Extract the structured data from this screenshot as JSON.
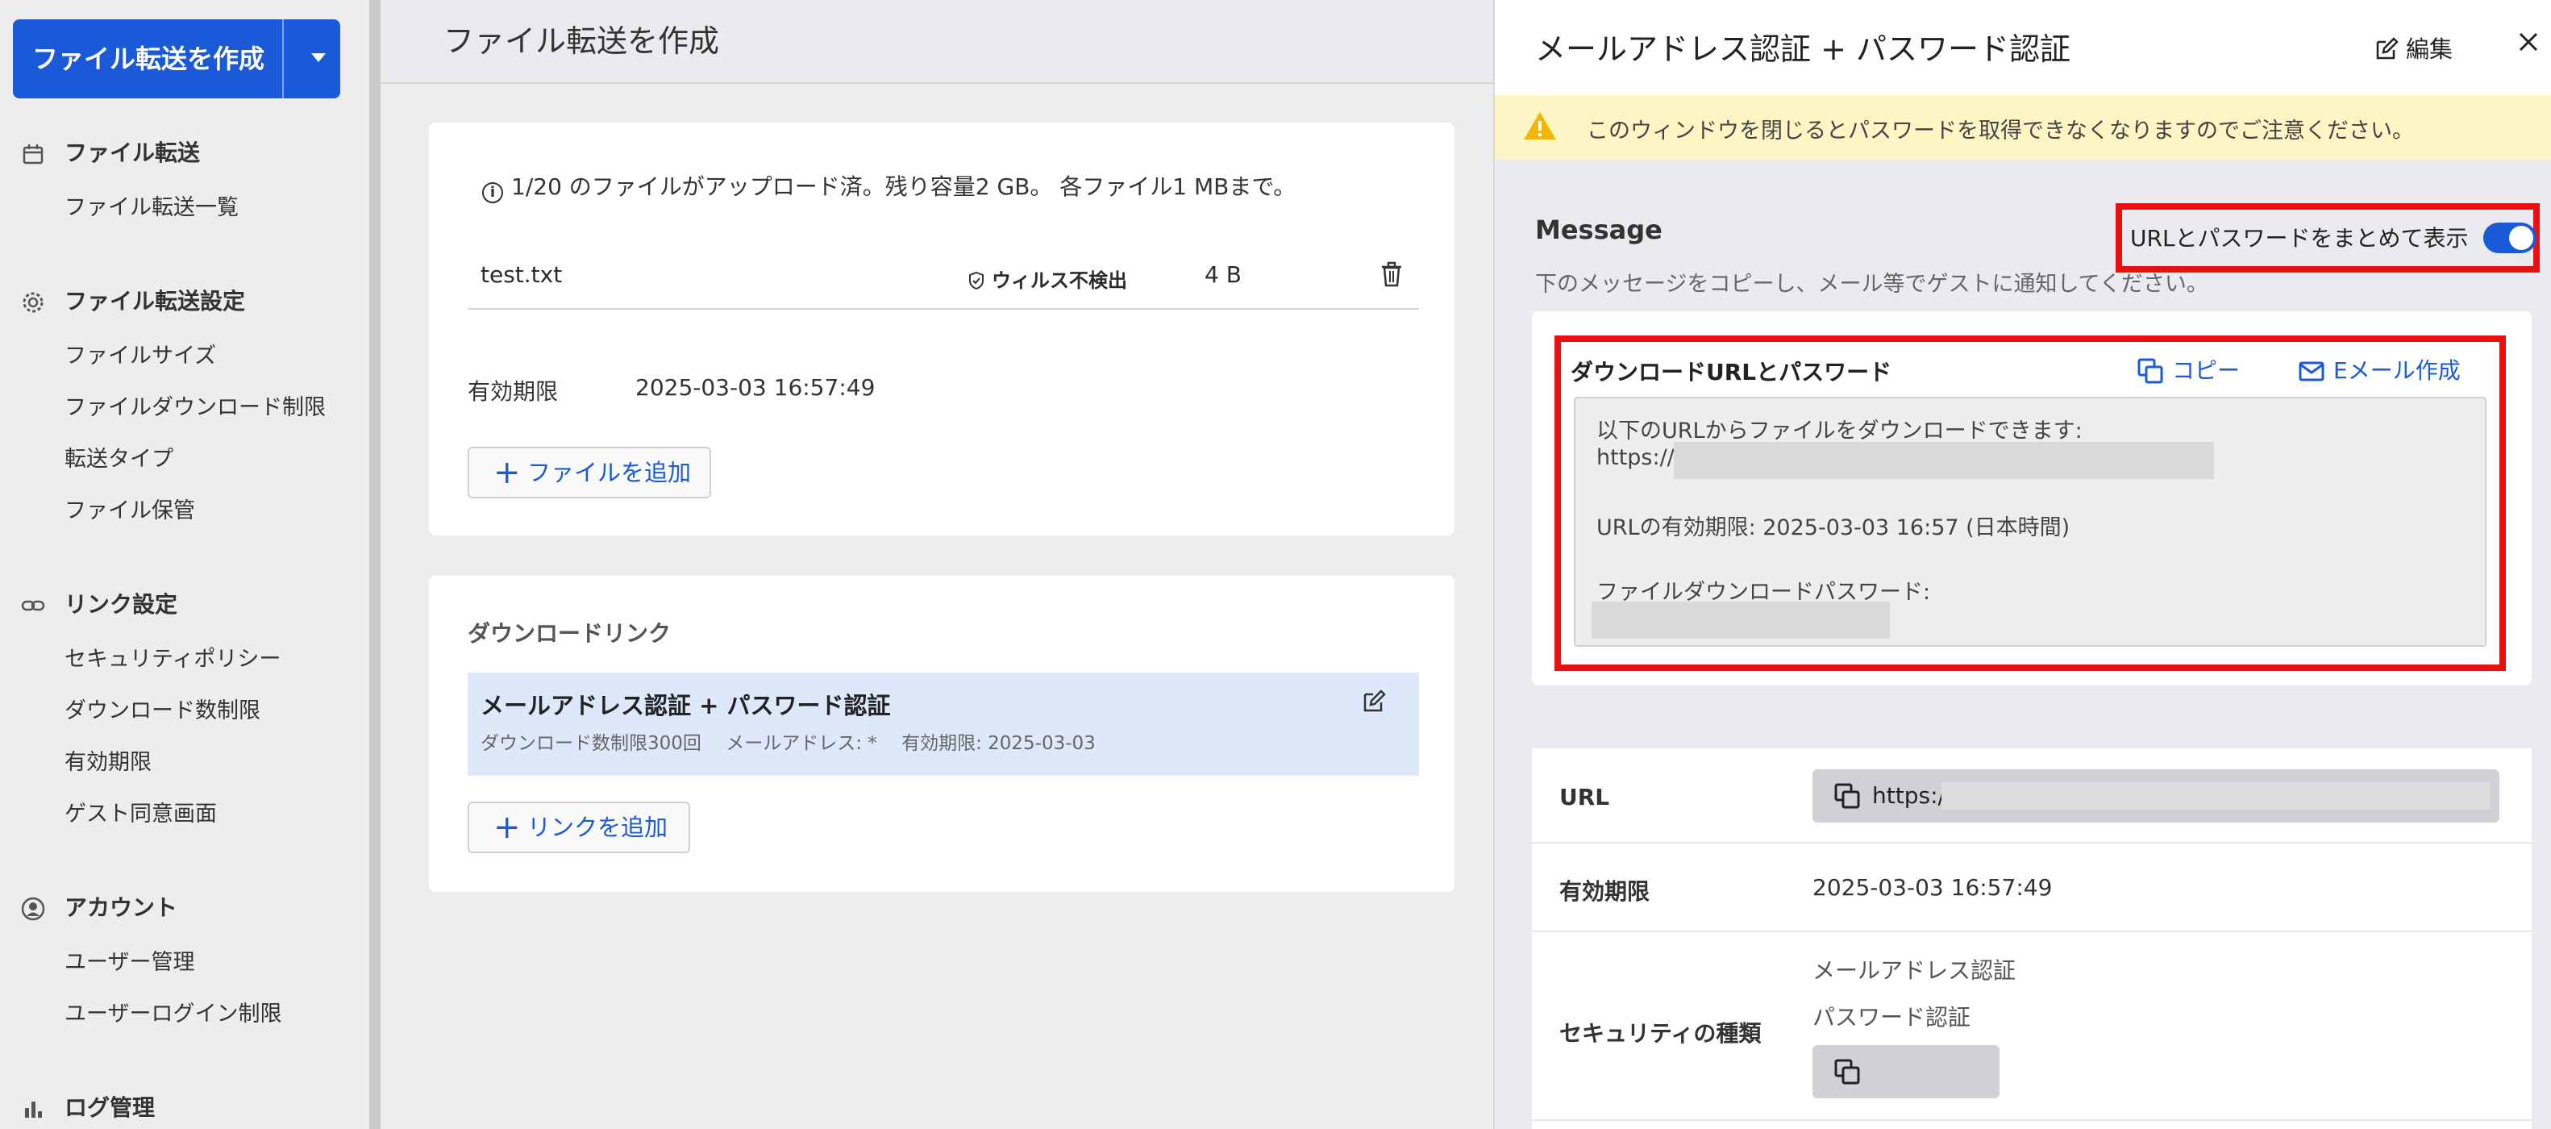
{
  "sidebar": {
    "create_button": "ファイル転送を作成",
    "sections": [
      {
        "title": "ファイル転送",
        "icon": "calendar-icon",
        "items": [
          "ファイル転送一覧"
        ]
      },
      {
        "title": "ファイル転送設定",
        "icon": "gear-icon",
        "items": [
          "ファイルサイズ",
          "ファイルダウンロード制限",
          "転送タイプ",
          "ファイル保管"
        ]
      },
      {
        "title": "リンク設定",
        "icon": "link-icon",
        "items": [
          "セキュリティポリシー",
          "ダウンロード数制限",
          "有効期限",
          "ゲスト同意画面"
        ]
      },
      {
        "title": "アカウント",
        "icon": "user-icon",
        "items": [
          "ユーザー管理",
          "ユーザーログイン制限"
        ]
      },
      {
        "title": "ログ管理",
        "icon": "bar-chart-icon",
        "items": []
      }
    ]
  },
  "main": {
    "title": "ファイル転送を作成",
    "files_card": {
      "info": "1/20 のファイルがアップロード済。残り容量2 GB。 各ファイル1 MBまで。",
      "file": {
        "name": "test.txt",
        "virus_status": "ウィルス不検出",
        "size": "4 B"
      },
      "expiry_label": "有効期限",
      "expiry_value": "2025-03-03 16:57:49",
      "add_file_button": "ファイルを追加"
    },
    "links_card": {
      "title": "ダウンロードリンク",
      "link": {
        "title": "メールアドレス認証 + パスワード認証",
        "meta": "ダウンロード数制限300回　 メールアドレス: *　 有効期限: 2025-03-03"
      },
      "add_link_button": "リンクを追加"
    }
  },
  "panel": {
    "title": "メールアドレス認証 + パスワード認証",
    "edit_label": "編集",
    "warning": "このウィンドウを閉じるとパスワードを取得できなくなりますのでご注意ください。",
    "message_title": "Message",
    "toggle_label": "URLとパスワードをまとめて表示",
    "toggle_on": true,
    "message_sub": "下のメッセージをコピーし、メール等でゲストに通知してください。",
    "box_title": "ダウンロードURLとパスワード",
    "copy_label": "コピー",
    "email_label": "Eメール作成",
    "message_lines": [
      "以下のURLからファイルをダウンロードできます:",
      "https://",
      "URLの有効期限: 2025-03-03 16:57 (日本時間)",
      "ファイルダウンロードパスワード:"
    ],
    "details": {
      "url_label": "URL",
      "url_value": "https:/",
      "expiry_label": "有効期限",
      "expiry_value": "2025-03-03 16:57:49",
      "security_label": "セキュリティの種類",
      "security_values": [
        "メールアドレス認証",
        "パスワード認証"
      ]
    }
  },
  "colors": {
    "accent": "#1a5ad8",
    "highlight": "#e8110f",
    "warning_bg": "#fdf6c4",
    "selected_bg": "#dde9fb"
  }
}
